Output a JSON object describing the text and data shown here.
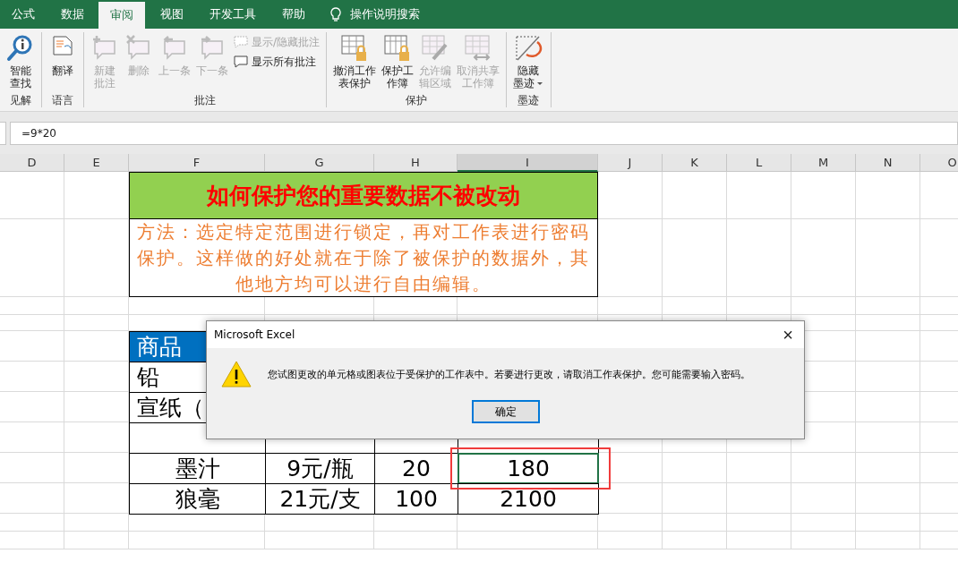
{
  "ribbon": {
    "tabs": [
      {
        "label": "公式",
        "selected": false
      },
      {
        "label": "数据",
        "selected": false
      },
      {
        "label": "审阅",
        "selected": true
      },
      {
        "label": "视图",
        "selected": false
      },
      {
        "label": "开发工具",
        "selected": false
      },
      {
        "label": "帮助",
        "selected": false
      }
    ],
    "search": {
      "label": "操作说明搜索"
    },
    "groups": [
      {
        "label": "见解",
        "buttons": [
          {
            "kind": "large",
            "label": "智能查找",
            "disabled": false
          }
        ]
      },
      {
        "label": "语言",
        "buttons": [
          {
            "kind": "large",
            "label": "翻译",
            "disabled": false
          }
        ]
      },
      {
        "label": "批注",
        "buttons": [
          {
            "kind": "large",
            "label": "新建批注",
            "disabled": true
          },
          {
            "kind": "large",
            "label": "删除",
            "disabled": true
          },
          {
            "kind": "large",
            "label": "上一条",
            "disabled": true
          },
          {
            "kind": "large",
            "label": "下一条",
            "disabled": true
          },
          {
            "kind": "small",
            "label": "显示/隐藏批注",
            "disabled": true
          },
          {
            "kind": "small",
            "label": "显示所有批注",
            "disabled": false
          }
        ]
      },
      {
        "label": "保护",
        "buttons": [
          {
            "kind": "large",
            "label": "撤消工作表保护",
            "disabled": false
          },
          {
            "kind": "large",
            "label": "保护工作簿",
            "disabled": false
          },
          {
            "kind": "large",
            "label": "允许编辑区域",
            "disabled": true
          },
          {
            "kind": "large",
            "label": "取消共享工作簿",
            "disabled": true
          }
        ]
      },
      {
        "label": "墨迹",
        "buttons": [
          {
            "kind": "menu",
            "label": "隐藏墨迹",
            "disabled": false
          }
        ]
      }
    ]
  },
  "formula_bar": {
    "value": "=9*20"
  },
  "sheet": {
    "columns": [
      {
        "label": "D",
        "selected": false
      },
      {
        "label": "E",
        "selected": false
      },
      {
        "label": "F",
        "selected": false
      },
      {
        "label": "G",
        "selected": false
      },
      {
        "label": "H",
        "selected": false
      },
      {
        "label": "I",
        "selected": true
      },
      {
        "label": "J",
        "selected": false
      },
      {
        "label": "K",
        "selected": false
      },
      {
        "label": "L",
        "selected": false
      },
      {
        "label": "M",
        "selected": false
      },
      {
        "label": "N",
        "selected": false
      },
      {
        "label": "O",
        "selected": false
      }
    ],
    "title": "如何保护您的重要数据不被改动",
    "note": "方法：选定特定范围进行锁定，再对工作表进行密码保护。这样做的好处就在于除了被保护的数据外，其他地方均可以进行自由编辑。",
    "table": {
      "rows": [
        {
          "kind": "header",
          "cells": [
            {
              "text": "商品",
              "selected": false
            }
          ]
        },
        {
          "kind": "body",
          "cells": [
            {
              "text": "铅",
              "selected": false
            }
          ]
        },
        {
          "kind": "body",
          "cells": [
            {
              "text": "宣纸（",
              "selected": false
            }
          ]
        },
        {
          "kind": "body"
        },
        {
          "kind": "body",
          "cells": [
            {
              "text": "墨汁",
              "selected": false
            },
            {
              "text": "9元/瓶",
              "selected": false
            },
            {
              "text": "20",
              "selected": false
            },
            {
              "text": "180",
              "selected": true
            }
          ]
        },
        {
          "kind": "body",
          "cells": [
            {
              "text": "狼毫",
              "selected": false
            },
            {
              "text": "21元/支",
              "selected": false
            },
            {
              "text": "100",
              "selected": false
            },
            {
              "text": "2100",
              "selected": false
            }
          ]
        }
      ]
    }
  },
  "dialog": {
    "title": "Microsoft Excel",
    "message": "您试图更改的单元格或图表位于受保护的工作表中。若要进行更改，请取消工作表保护。您可能需要输入密码。",
    "close": "×",
    "buttons": [
      {
        "label": "确定",
        "focused": true
      }
    ]
  }
}
